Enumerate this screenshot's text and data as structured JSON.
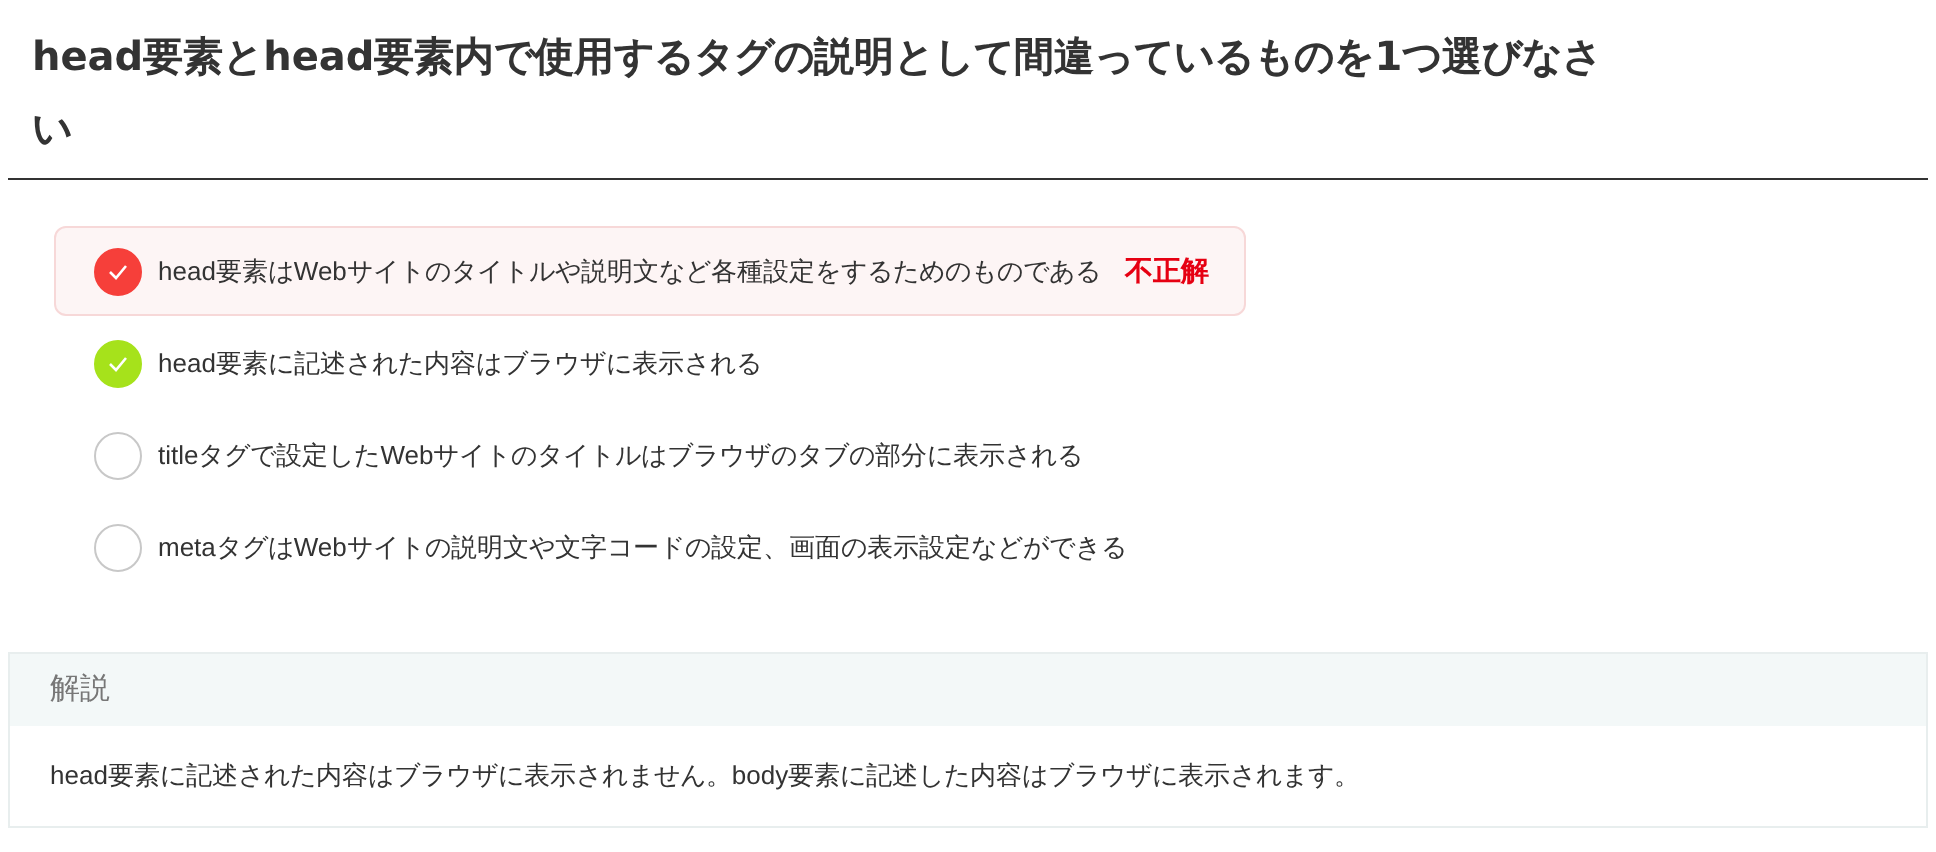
{
  "question": {
    "title": "head要素とhead要素内で使用するタグの説明として間違っているものを1つ選びなさい"
  },
  "options": [
    {
      "text": "head要素はWebサイトのタイトルや説明文など各種設定をするためのものである",
      "kind": "incorrect",
      "selected": true,
      "result": "不正解"
    },
    {
      "text": "head要素に記述された内容はブラウザに表示される",
      "kind": "correct",
      "selected": false
    },
    {
      "text": "titleタグで設定したWebサイトのタイトルはブラウザのタブの部分に表示される",
      "kind": "blank",
      "selected": false
    },
    {
      "text": "metaタグはWebサイトの説明文や文字コードの設定、画面の表示設定などができる",
      "kind": "blank",
      "selected": false
    }
  ],
  "explanation": {
    "heading": "解説",
    "body": "head要素に記述された内容はブラウザに表示されません。body要素に記述した内容はブラウザに表示されます。"
  }
}
